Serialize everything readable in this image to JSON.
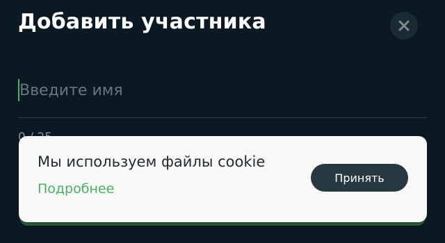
{
  "dialog": {
    "title": "Добавить участника",
    "close_icon": "close-icon"
  },
  "name_input": {
    "value": "",
    "placeholder": "Введите имя",
    "counter": "0 / 25"
  },
  "cookie_banner": {
    "message": "Мы используем файлы cookie",
    "more_link": "Подробнее",
    "accept_label": "Принять"
  },
  "colors": {
    "background": "#0b1a22",
    "accent": "#4caf68",
    "banner_bg": "#f8f8f7",
    "button_bg": "#283941"
  }
}
